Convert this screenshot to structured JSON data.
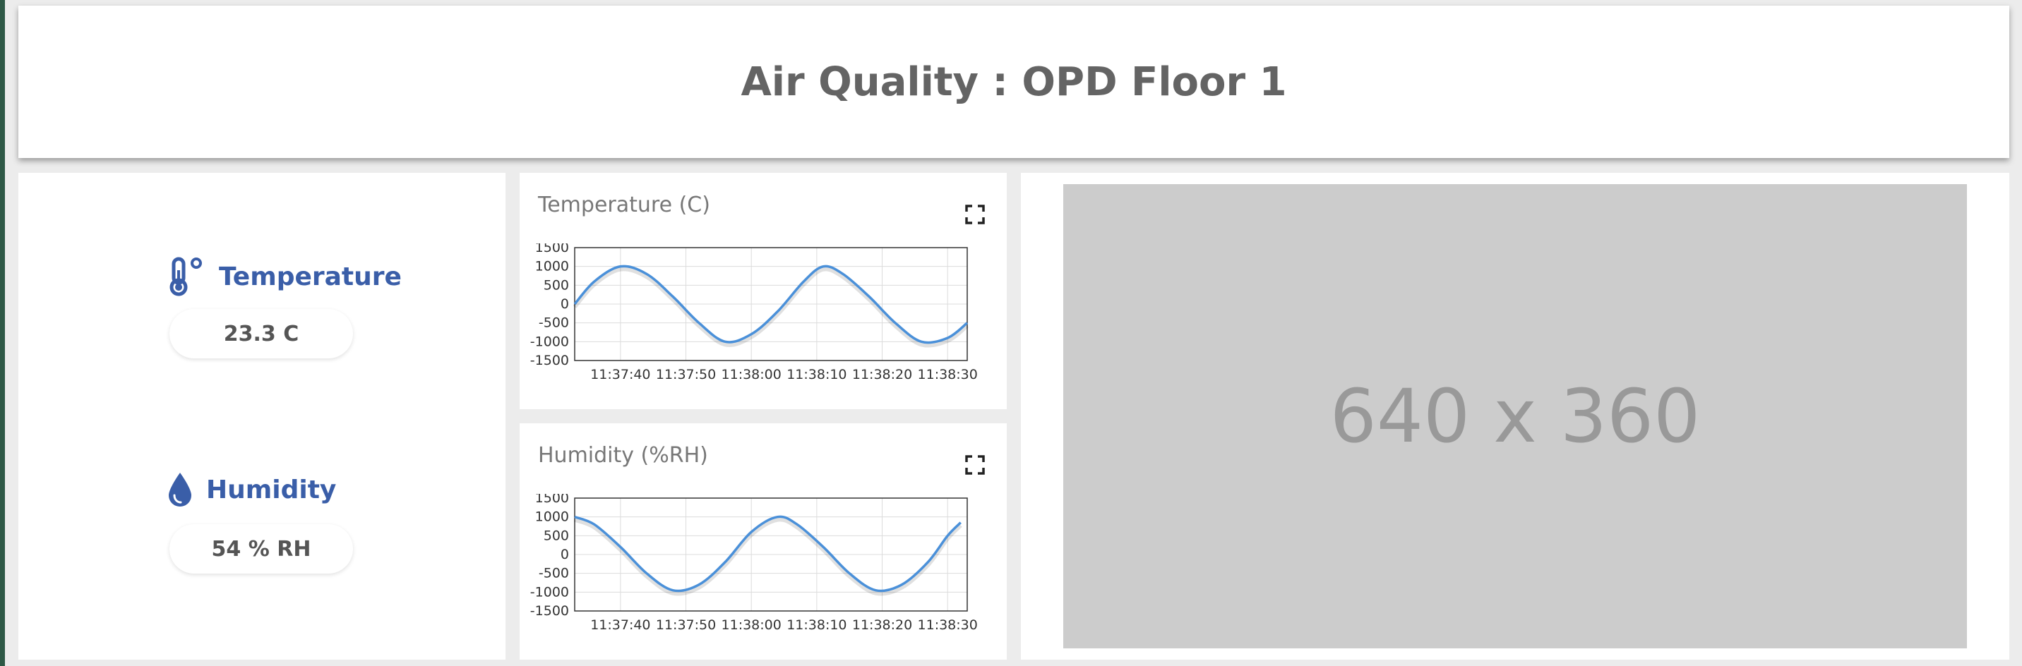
{
  "header": {
    "title": "Air Quality : OPD Floor 1"
  },
  "sensors": {
    "temperature": {
      "label": "Temperature",
      "value": "23.3 C",
      "icon": "thermometer-icon"
    },
    "humidity": {
      "label": "Humidity",
      "value": "54 % RH",
      "icon": "water-drop-icon"
    }
  },
  "charts": {
    "temperature": {
      "title": "Temperature (C)",
      "expand_icon": "fullscreen-icon"
    },
    "humidity": {
      "title": "Humidity (%RH)",
      "expand_icon": "fullscreen-icon"
    }
  },
  "video": {
    "placeholder_text": "640 x 360"
  },
  "colors": {
    "accent": "#3a5ea8",
    "line": "#4a90d9",
    "edge": "#2e5946"
  },
  "chart_data": [
    {
      "type": "line",
      "title": "Temperature (C)",
      "x_ticks": [
        "11:37:40",
        "11:37:50",
        "11:38:00",
        "11:38:10",
        "11:38:20",
        "11:38:30"
      ],
      "y_ticks": [
        1500,
        1000,
        500,
        0,
        -500,
        -1000,
        -1500
      ],
      "ylim": [
        -1500,
        1500
      ],
      "xlim": [
        "11:37:33",
        "11:38:33"
      ],
      "grid": true,
      "series": [
        {
          "x": [
            "11:37:33",
            "11:37:36",
            "11:37:40",
            "11:37:44",
            "11:37:48",
            "11:37:52",
            "11:37:56",
            "11:38:00",
            "11:38:04",
            "11:38:08",
            "11:38:11",
            "11:38:14",
            "11:38:18",
            "11:38:22",
            "11:38:26",
            "11:38:30",
            "11:38:33"
          ],
          "values": [
            0,
            600,
            1000,
            800,
            200,
            -500,
            -1000,
            -800,
            -200,
            600,
            1000,
            800,
            200,
            -500,
            -1000,
            -900,
            -500
          ]
        }
      ]
    },
    {
      "type": "line",
      "title": "Humidity (%RH)",
      "x_ticks": [
        "11:37:40",
        "11:37:50",
        "11:38:00",
        "11:38:10",
        "11:38:20",
        "11:38:30"
      ],
      "y_ticks": [
        1500,
        1000,
        500,
        0,
        -500,
        -1000,
        -1500
      ],
      "ylim": [
        -1500,
        1500
      ],
      "xlim": [
        "11:37:33",
        "11:38:33"
      ],
      "grid": true,
      "series": [
        {
          "x": [
            "11:37:33",
            "11:37:36",
            "11:37:40",
            "11:37:44",
            "11:37:48",
            "11:37:52",
            "11:37:56",
            "11:38:00",
            "11:38:04",
            "11:38:07",
            "11:38:11",
            "11:38:15",
            "11:38:19",
            "11:38:23",
            "11:38:27",
            "11:38:30",
            "11:38:32"
          ],
          "values": [
            1000,
            800,
            200,
            -500,
            -950,
            -800,
            -200,
            600,
            1000,
            800,
            200,
            -500,
            -950,
            -800,
            -200,
            500,
            850
          ]
        }
      ]
    }
  ]
}
